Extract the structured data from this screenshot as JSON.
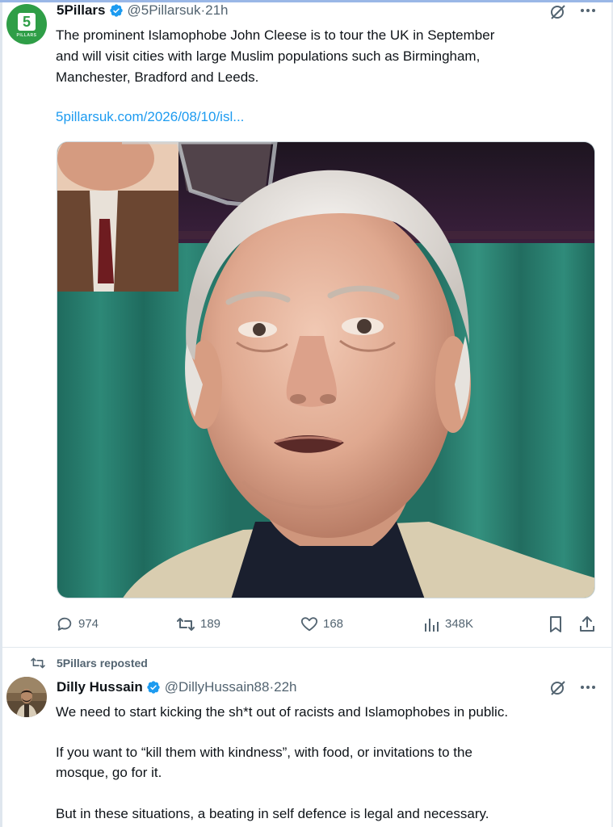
{
  "tweet1": {
    "avatar": {
      "badge": "5",
      "tag": "PILLARS"
    },
    "name": "5Pillars",
    "handle": "@5Pillarsuk",
    "separator": " · ",
    "time": "21h",
    "text_lines": [
      "The prominent Islamophobe John Cleese is to tour the UK in September",
      "and will visit cities with large Muslim populations such as Birmingham,",
      "Manchester, Bradford and Leeds."
    ],
    "link": "5pillarsuk.com/2026/08/10/isl...",
    "photo_icon": "portrait-photo",
    "actions": {
      "replies": "974",
      "reposts": "189",
      "likes": "168",
      "views": "348K"
    }
  },
  "repost_label": "5Pillars reposted",
  "tweet2": {
    "name": "Dilly Hussain",
    "handle": "@DillyHussain88",
    "separator": " · ",
    "time": "22h",
    "text_lines": [
      "We need to start kicking the sh*t out of racists and Islamophobes in public.",
      "If you want to “kill them with kindness”, with food, or invitations to the",
      "mosque, go for it.",
      "But in these situations, a beating in self defence is legal and necessary."
    ]
  },
  "colors": {
    "text": "#0f1419",
    "secondary": "#536471",
    "link": "#1d9bf0",
    "verified": "#1d9bf0",
    "avatar_green": "#2f9e47"
  }
}
